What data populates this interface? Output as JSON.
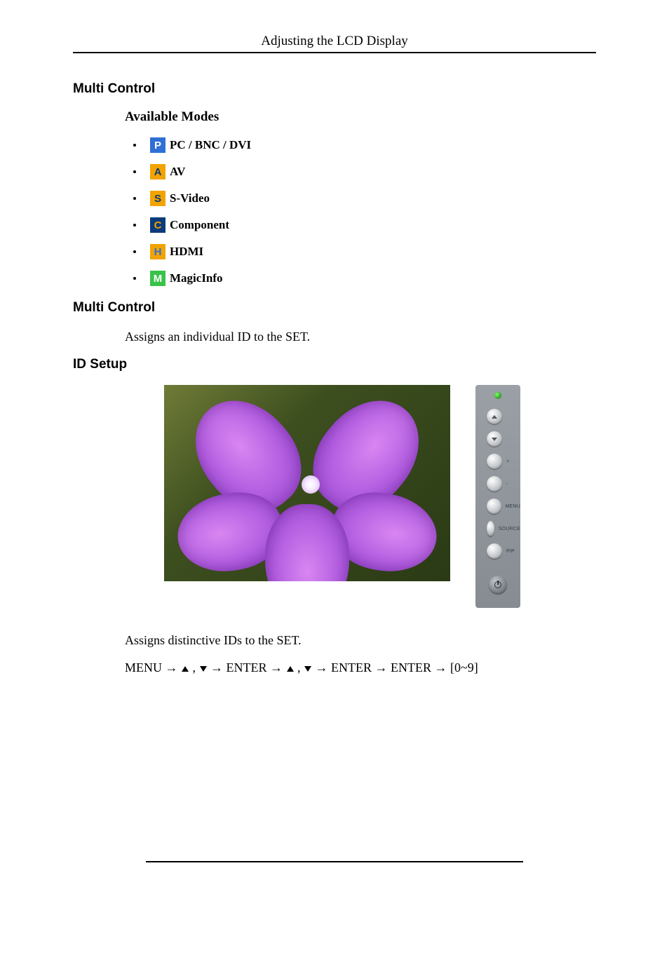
{
  "page_title": "Adjusting the LCD Display",
  "sections": {
    "multi_control_1": "Multi Control",
    "available_modes": "Available Modes",
    "multi_control_2": "Multi Control",
    "id_setup": "ID Setup"
  },
  "modes": [
    {
      "letter": "P",
      "bg": "#2f6fd6",
      "fg": "#ffffff",
      "label": "PC / BNC / DVI"
    },
    {
      "letter": "A",
      "bg": "#f2a300",
      "fg": "#0b3b7a",
      "label": "AV"
    },
    {
      "letter": "S",
      "bg": "#f2a300",
      "fg": "#0b3b7a",
      "label": "S-Video"
    },
    {
      "letter": "C",
      "bg": "#0b3b7a",
      "fg": "#f2a300",
      "label": "Component"
    },
    {
      "letter": "H",
      "bg": "#f2a300",
      "fg": "#2f6fd6",
      "label": "HDMI"
    },
    {
      "letter": "M",
      "bg": "#39c24a",
      "fg": "#ffffff",
      "label": "MagicInfo"
    }
  ],
  "multi_control_desc": "Assigns an individual ID to the SET.",
  "id_setup_desc": "Assigns distinctive IDs to the SET.",
  "side_panel": {
    "labels": [
      "",
      "",
      "+",
      "-",
      "MENU",
      "SOURCE",
      "PIP"
    ],
    "power_label": ""
  },
  "nav": {
    "menu": "MENU",
    "enter": "ENTER",
    "range": "[0~9]",
    "arrow": "→",
    "comma": ","
  }
}
